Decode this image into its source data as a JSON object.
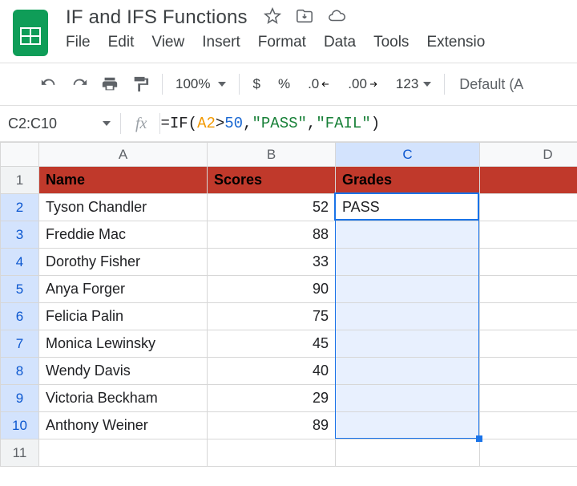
{
  "doc_title": "IF and IFS Functions",
  "menu": {
    "file": "File",
    "edit": "Edit",
    "view": "View",
    "insert": "Insert",
    "format": "Format",
    "data": "Data",
    "tools": "Tools",
    "extensions": "Extensio"
  },
  "toolbar": {
    "zoom": "100%",
    "currency": "$",
    "percent": "%",
    "dec_dec": ".0",
    "inc_dec": ".00",
    "more_fmt": "123",
    "font_label": "Default (A"
  },
  "namebox": "C2:C10",
  "fx_label": "fx",
  "formula": {
    "eq": "=",
    "fn": "IF",
    "open": "(",
    "ref": "A2",
    "gt": ">",
    "fifty": "50",
    "c1": ", ",
    "pass": "\"PASS\"",
    "c2": ", ",
    "fail": "\"FAIL\"",
    "close": ")"
  },
  "cols": {
    "A": "A",
    "B": "B",
    "C": "C",
    "D": "D"
  },
  "rows": {
    "r1": "1",
    "r2": "2",
    "r3": "3",
    "r4": "4",
    "r5": "5",
    "r6": "6",
    "r7": "7",
    "r8": "8",
    "r9": "9",
    "r10": "10",
    "r11": "11"
  },
  "headers": {
    "name": "Name",
    "scores": "Scores",
    "grades": "Grades"
  },
  "table": [
    {
      "name": "Tyson Chandler",
      "score": "52",
      "grade": "PASS"
    },
    {
      "name": "Freddie Mac",
      "score": "88",
      "grade": ""
    },
    {
      "name": "Dorothy Fisher",
      "score": "33",
      "grade": ""
    },
    {
      "name": "Anya Forger",
      "score": "90",
      "grade": ""
    },
    {
      "name": "Felicia Palin",
      "score": "75",
      "grade": ""
    },
    {
      "name": "Monica Lewinsky",
      "score": "45",
      "grade": ""
    },
    {
      "name": "Wendy Davis",
      "score": "40",
      "grade": ""
    },
    {
      "name": "Victoria Beckham",
      "score": "29",
      "grade": ""
    },
    {
      "name": "Anthony Weiner",
      "score": "89",
      "grade": ""
    }
  ]
}
